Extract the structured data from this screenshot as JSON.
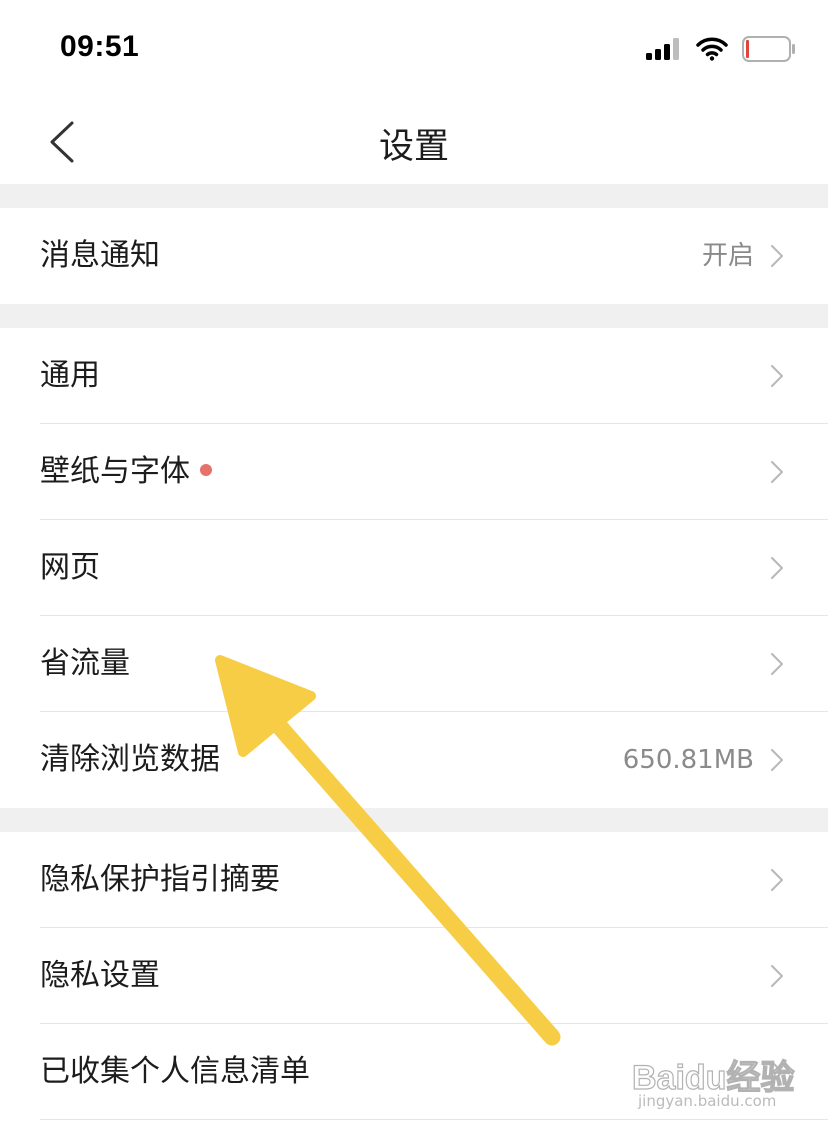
{
  "status_bar": {
    "time": "09:51",
    "icons": [
      "signal-icon",
      "wifi-icon",
      "battery-icon"
    ],
    "battery_color": "#e0443a"
  },
  "nav": {
    "back_icon": "chevron-left-icon",
    "title": "设置"
  },
  "groups": [
    {
      "rows": [
        {
          "label": "消息通知",
          "value": "开启"
        }
      ]
    },
    {
      "rows": [
        {
          "label": "通用"
        },
        {
          "label": "壁纸与字体",
          "badge": "red-dot"
        },
        {
          "label": "网页"
        },
        {
          "label": "省流量"
        },
        {
          "label": "清除浏览数据",
          "value": "650.81MB"
        }
      ]
    },
    {
      "rows": [
        {
          "label": "隐私保护指引摘要"
        },
        {
          "label": "隐私设置"
        },
        {
          "label": "已收集个人信息清单"
        }
      ]
    }
  ],
  "overlay": {
    "arrow_color": "#f7cd46",
    "arrow_target": "省流量"
  },
  "watermark": {
    "brand": "Baidu经验",
    "url": "jingyan.baidu.com"
  },
  "colors": {
    "section_gap": "#f0f0f0",
    "separator": "#e6e6e6",
    "value_text": "#8a8a8a",
    "badge": "#e5726c"
  }
}
